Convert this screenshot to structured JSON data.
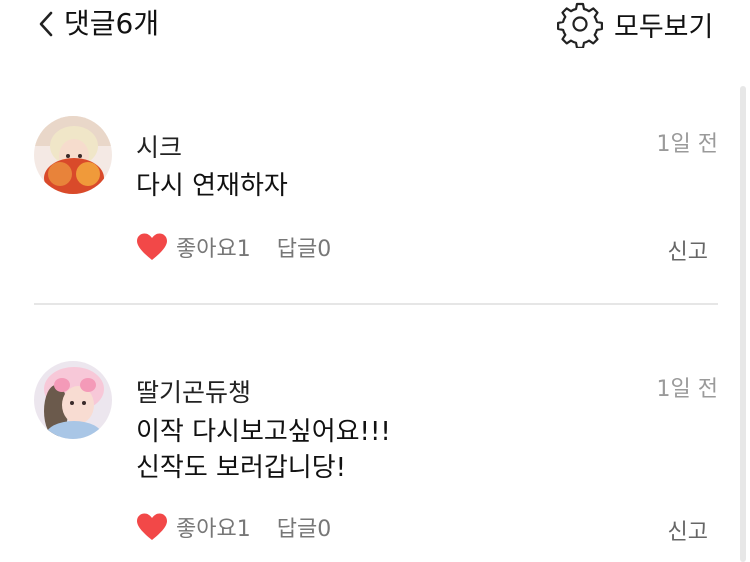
{
  "header": {
    "back_icon": "chevron-left-icon",
    "title": "댓글6개",
    "settings_icon": "gear-icon",
    "view_all_label": "모두보기"
  },
  "comments": [
    {
      "author": "시크",
      "time": "1일 전",
      "body": "다시 연재하자",
      "like_label": "좋아요1",
      "reply_label": "답글0",
      "report_label": "신고"
    },
    {
      "author": "딸기곤듀챙",
      "time": "1일 전",
      "body": "이작 다시보고싶어요!!!\n신작도 보러갑니당!",
      "like_label": "좋아요1",
      "reply_label": "답글0",
      "report_label": "신고"
    }
  ],
  "colors": {
    "heart": "#f24848",
    "muted_text": "#9a9a9a",
    "divider": "#e6e6e6"
  }
}
